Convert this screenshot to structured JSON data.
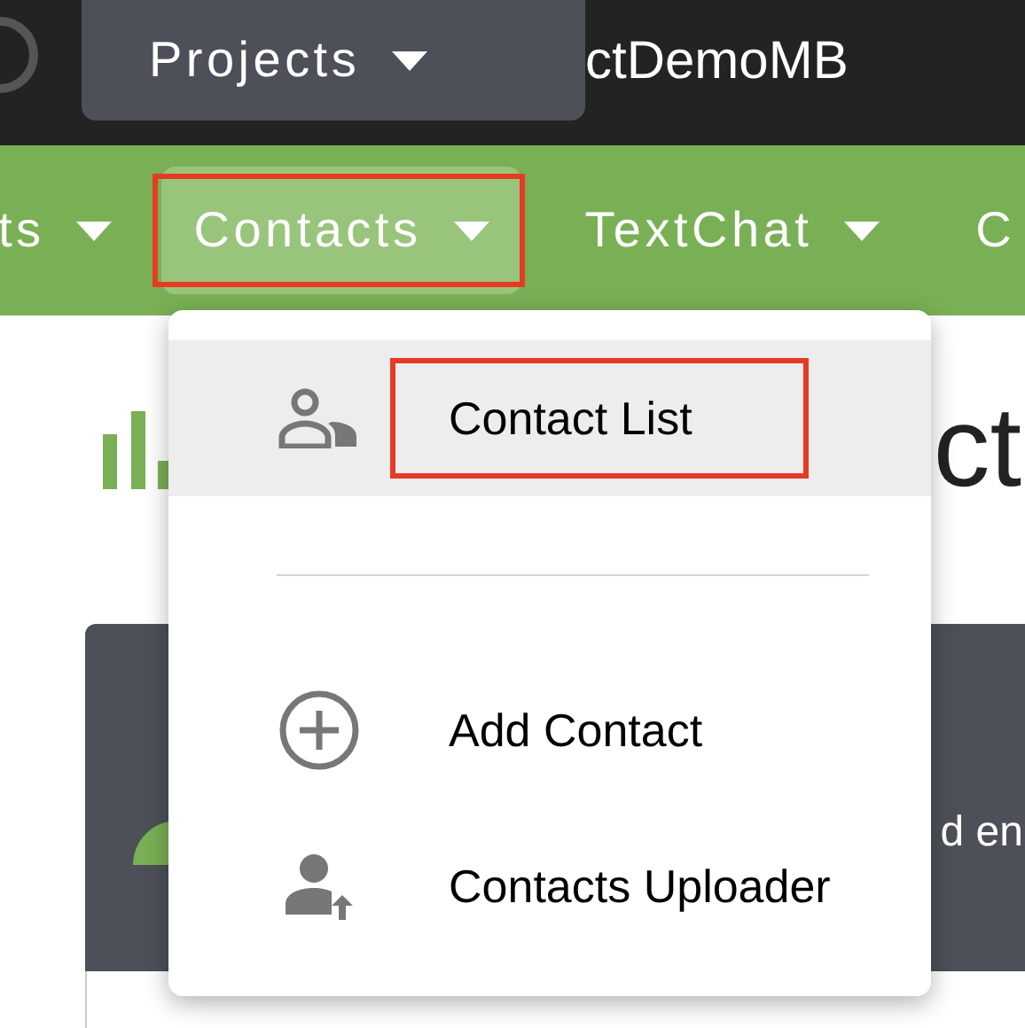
{
  "top_bar": {
    "projects_button": "Projects",
    "project_name": "ctDemoMB"
  },
  "nav": {
    "items": [
      {
        "label": "ts",
        "selected": false,
        "annotated": false,
        "has_caret": true
      },
      {
        "label": "Contacts",
        "selected": true,
        "annotated": true,
        "has_caret": true
      },
      {
        "label": "TextChat",
        "selected": false,
        "annotated": false,
        "has_caret": true
      },
      {
        "label": "C",
        "selected": false,
        "annotated": false,
        "has_caret": false
      }
    ]
  },
  "page": {
    "heading": "ct",
    "card_text": "d en"
  },
  "menu": {
    "items": [
      {
        "kind": "item",
        "label": "Contact List",
        "selected": true,
        "annotated": true
      },
      {
        "kind": "divider"
      },
      {
        "kind": "item",
        "label": "Add Contact",
        "selected": false,
        "annotated": false
      },
      {
        "kind": "item",
        "label": "Contacts Uploader",
        "selected": false,
        "annotated": false
      }
    ]
  }
}
